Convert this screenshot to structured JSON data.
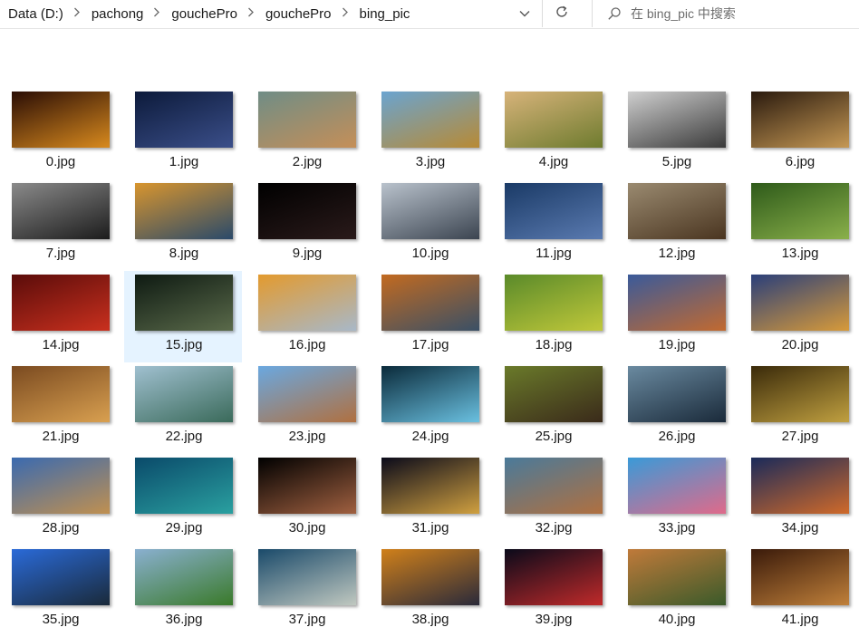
{
  "address": {
    "crumbs": [
      "Data (D:)",
      "pachong",
      "gouchePro",
      "gouchePro",
      "bing_pic"
    ],
    "separator_icon": "chevron-right-icon"
  },
  "search": {
    "placeholder": "在 bing_pic 中搜索"
  },
  "files": [
    {
      "name": "0.jpg",
      "c1": "#2a0d05",
      "c2": "#d88a1e"
    },
    {
      "name": "1.jpg",
      "c1": "#0c1a3a",
      "c2": "#3b4f8a"
    },
    {
      "name": "2.jpg",
      "c1": "#6f8d86",
      "c2": "#c58f58"
    },
    {
      "name": "3.jpg",
      "c1": "#6aa4d0",
      "c2": "#b88a34"
    },
    {
      "name": "4.jpg",
      "c1": "#d7b37a",
      "c2": "#6e7b2e"
    },
    {
      "name": "5.jpg",
      "c1": "#cfcfcf",
      "c2": "#3a3a3a"
    },
    {
      "name": "6.jpg",
      "c1": "#2a1a0e",
      "c2": "#c59854"
    },
    {
      "name": "7.jpg",
      "c1": "#8a8a8a",
      "c2": "#1c1c1c"
    },
    {
      "name": "8.jpg",
      "c1": "#d8952e",
      "c2": "#2a4a6a"
    },
    {
      "name": "9.jpg",
      "c1": "#000000",
      "c2": "#2a1a1a"
    },
    {
      "name": "10.jpg",
      "c1": "#b9c2cc",
      "c2": "#3b4450"
    },
    {
      "name": "11.jpg",
      "c1": "#1a3a66",
      "c2": "#5a7ab0"
    },
    {
      "name": "12.jpg",
      "c1": "#9a8a70",
      "c2": "#4a3520"
    },
    {
      "name": "13.jpg",
      "c1": "#2e5a1a",
      "c2": "#8ab04a"
    },
    {
      "name": "14.jpg",
      "c1": "#5a0c0a",
      "c2": "#c9301e"
    },
    {
      "name": "15.jpg",
      "c1": "#0e1a12",
      "c2": "#5a6a4a"
    },
    {
      "name": "16.jpg",
      "c1": "#e39a2e",
      "c2": "#a8b8c8"
    },
    {
      "name": "17.jpg",
      "c1": "#c26a20",
      "c2": "#3a5066"
    },
    {
      "name": "18.jpg",
      "c1": "#5a8a2a",
      "c2": "#c0c83a"
    },
    {
      "name": "19.jpg",
      "c1": "#3a5a9a",
      "c2": "#c26a30"
    },
    {
      "name": "20.jpg",
      "c1": "#2a3f7a",
      "c2": "#d79a3a"
    },
    {
      "name": "21.jpg",
      "c1": "#7a4a20",
      "c2": "#d9a050"
    },
    {
      "name": "22.jpg",
      "c1": "#a0c0d0",
      "c2": "#3a6a5a"
    },
    {
      "name": "23.jpg",
      "c1": "#6aa8e0",
      "c2": "#b07040"
    },
    {
      "name": "24.jpg",
      "c1": "#0a2a3a",
      "c2": "#6ac0e0"
    },
    {
      "name": "25.jpg",
      "c1": "#6a7a2a",
      "c2": "#3a2a1a"
    },
    {
      "name": "26.jpg",
      "c1": "#6a8aa0",
      "c2": "#1a2a3a"
    },
    {
      "name": "27.jpg",
      "c1": "#3a2a0a",
      "c2": "#c0a040"
    },
    {
      "name": "28.jpg",
      "c1": "#3a6ab0",
      "c2": "#c09050"
    },
    {
      "name": "29.jpg",
      "c1": "#0a4a6a",
      "c2": "#2aa0a0"
    },
    {
      "name": "30.jpg",
      "c1": "#000000",
      "c2": "#a06040"
    },
    {
      "name": "31.jpg",
      "c1": "#0a0a1a",
      "c2": "#d0a040"
    },
    {
      "name": "32.jpg",
      "c1": "#4a7a9a",
      "c2": "#b07040"
    },
    {
      "name": "33.jpg",
      "c1": "#3a9ad8",
      "c2": "#e06a8a"
    },
    {
      "name": "34.jpg",
      "c1": "#1a2a5a",
      "c2": "#d06a2a"
    },
    {
      "name": "35.jpg",
      "c1": "#2a6ad8",
      "c2": "#1a2a3a"
    },
    {
      "name": "36.jpg",
      "c1": "#8ab0d0",
      "c2": "#3a7a2a"
    },
    {
      "name": "37.jpg",
      "c1": "#1a4a6a",
      "c2": "#c0c8c0"
    },
    {
      "name": "38.jpg",
      "c1": "#d0801a",
      "c2": "#2a2a3a"
    },
    {
      "name": "39.jpg",
      "c1": "#0a0a1a",
      "c2": "#c02a2a"
    },
    {
      "name": "40.jpg",
      "c1": "#c07a3a",
      "c2": "#3a5a2a"
    },
    {
      "name": "41.jpg",
      "c1": "#3a1a0a",
      "c2": "#c0803a"
    }
  ],
  "selected_index": 15,
  "colors": {
    "selection": "#e5f3ff",
    "text": "#1a1a1a"
  }
}
